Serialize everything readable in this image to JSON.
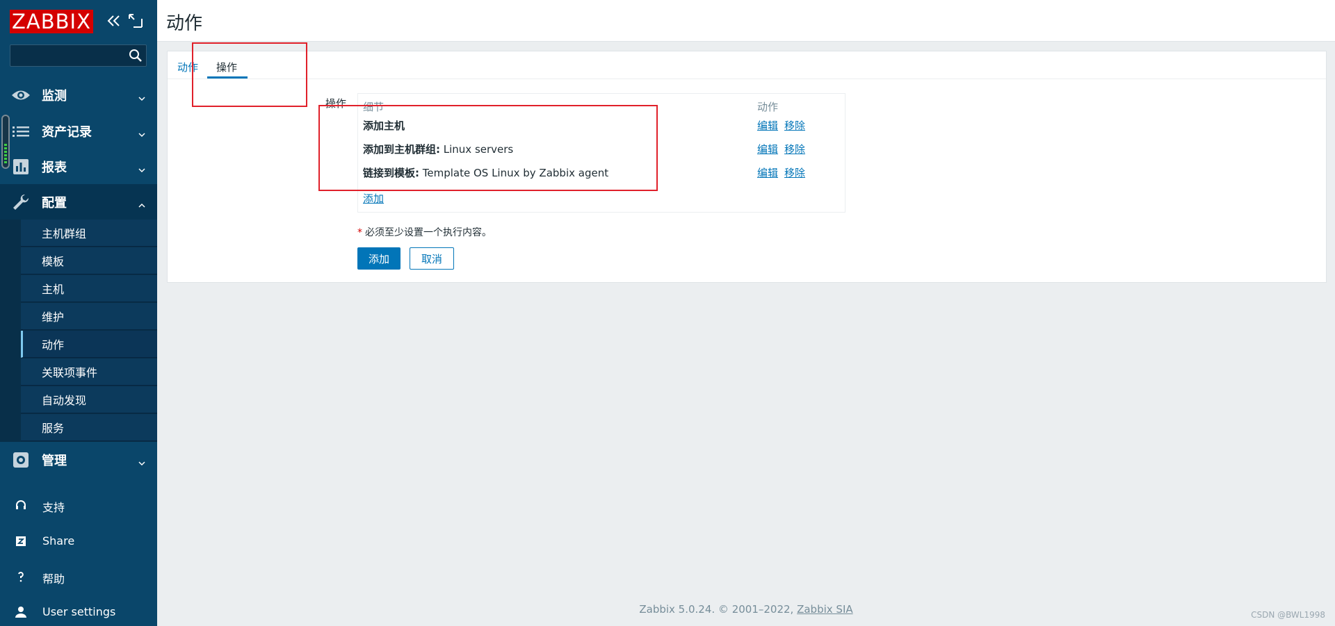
{
  "sidebar": {
    "logo": "ZABBIX",
    "search": {
      "value": "",
      "placeholder": ""
    },
    "menu": {
      "monitoring": "监测",
      "inventory": "资产记录",
      "reports": "报表",
      "configuration": "配置",
      "administration": "管理"
    },
    "config_items": [
      "主机群组",
      "模板",
      "主机",
      "维护",
      "动作",
      "关联项事件",
      "自动发现",
      "服务"
    ],
    "bottom": {
      "support": "支持",
      "share": "Share",
      "help": "帮助",
      "user_settings": "User settings"
    }
  },
  "header": {
    "title": "动作"
  },
  "tabs": {
    "actions": "动作",
    "operations": "操作"
  },
  "operations": {
    "label": "操作",
    "col_details": "细节",
    "col_action": "动作",
    "rows": [
      {
        "bold": "添加主机",
        "text": "",
        "edit": "编辑",
        "remove": "移除"
      },
      {
        "bold": "添加到主机群组:",
        "text": " Linux servers",
        "edit": "编辑",
        "remove": "移除"
      },
      {
        "bold": "链接到模板:",
        "text": " Template OS Linux by Zabbix agent",
        "edit": "编辑",
        "remove": "移除"
      }
    ],
    "add_link": "添加"
  },
  "form": {
    "required_star": "*",
    "required_note": "必须至少设置一个执行内容。",
    "add_button": "添加",
    "cancel_button": "取消"
  },
  "footer": {
    "text": "Zabbix 5.0.24. © 2001–2022, ",
    "link": "Zabbix SIA"
  },
  "watermark": "CSDN @BWL1998",
  "colors": {
    "sidebar": "#0a466a",
    "brand_red": "#d40000",
    "link_blue": "#0275b8",
    "annotation_red": "#e0202a"
  }
}
